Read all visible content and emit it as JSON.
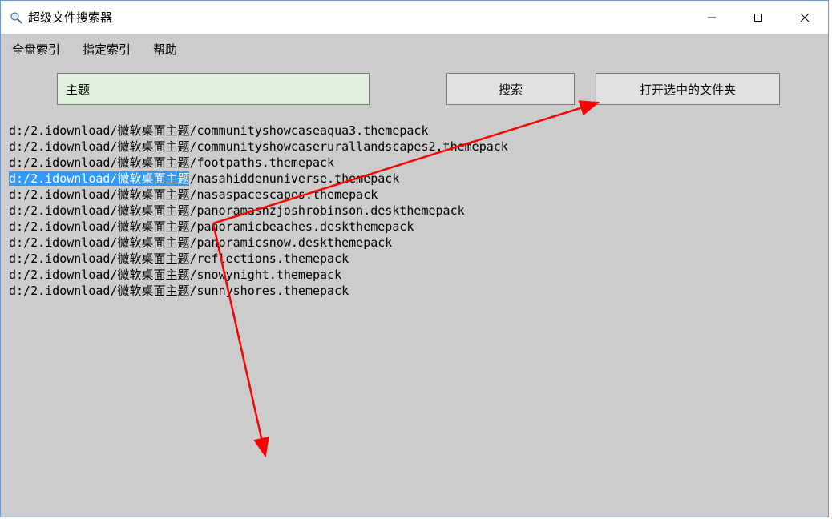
{
  "window": {
    "title": "超级文件搜索器"
  },
  "menubar": {
    "items": [
      {
        "label": "全盘索引"
      },
      {
        "label": "指定索引"
      },
      {
        "label": "帮助"
      }
    ]
  },
  "toolbar": {
    "search_value": "主题",
    "search_label": "搜索",
    "open_label": "打开选中的文件夹"
  },
  "results": {
    "selected_index": 3,
    "selected_prefix": "d:/2.idownload/微软桌面主题",
    "items": [
      {
        "path": "d:/2.idownload/微软桌面主题/communityshowcaseaqua3.themepack"
      },
      {
        "path": "d:/2.idownload/微软桌面主题/communityshowcaserurallandscapes2.themepack"
      },
      {
        "path": "d:/2.idownload/微软桌面主题/footpaths.themepack"
      },
      {
        "path": "d:/2.idownload/微软桌面主题/nasahiddenuniverse.themepack"
      },
      {
        "path": "d:/2.idownload/微软桌面主题/nasaspacescapes.themepack"
      },
      {
        "path": "d:/2.idownload/微软桌面主题/panoramasnzjoshrobinson.deskthemepack"
      },
      {
        "path": "d:/2.idownload/微软桌面主题/panoramicbeaches.deskthemepack"
      },
      {
        "path": "d:/2.idownload/微软桌面主题/panoramicsnow.deskthemepack"
      },
      {
        "path": "d:/2.idownload/微软桌面主题/reflections.themepack"
      },
      {
        "path": "d:/2.idownload/微软桌面主题/snowynight.themepack"
      },
      {
        "path": "d:/2.idownload/微软桌面主题/sunnyshores.themepack"
      }
    ]
  }
}
